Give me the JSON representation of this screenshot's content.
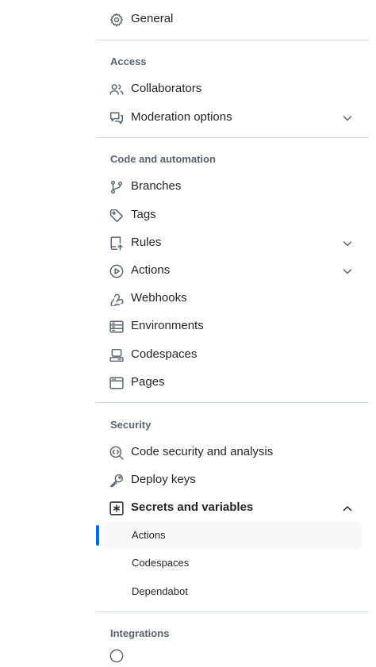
{
  "sidebar": {
    "general": {
      "label": "General",
      "icon": "gear-icon"
    },
    "access": {
      "title": "Access",
      "items": [
        {
          "label": "Collaborators",
          "icon": "people-icon"
        },
        {
          "label": "Moderation options",
          "icon": "comment-discussion-icon",
          "expandable": true,
          "expanded": false
        }
      ]
    },
    "code_automation": {
      "title": "Code and automation",
      "items": [
        {
          "label": "Branches",
          "icon": "git-branch-icon"
        },
        {
          "label": "Tags",
          "icon": "tag-icon"
        },
        {
          "label": "Rules",
          "icon": "repo-push-icon",
          "expandable": true,
          "expanded": false
        },
        {
          "label": "Actions",
          "icon": "play-icon",
          "expandable": true,
          "expanded": false
        },
        {
          "label": "Webhooks",
          "icon": "webhook-icon"
        },
        {
          "label": "Environments",
          "icon": "server-icon"
        },
        {
          "label": "Codespaces",
          "icon": "codespaces-icon"
        },
        {
          "label": "Pages",
          "icon": "browser-icon"
        }
      ]
    },
    "security": {
      "title": "Security",
      "items": [
        {
          "label": "Code security and analysis",
          "icon": "codescan-icon"
        },
        {
          "label": "Deploy keys",
          "icon": "key-icon"
        },
        {
          "label": "Secrets and variables",
          "icon": "asterisk-icon",
          "expandable": true,
          "expanded": true
        }
      ],
      "subitems": [
        {
          "label": "Actions",
          "active": true
        },
        {
          "label": "Codespaces",
          "active": false
        },
        {
          "label": "Dependabot",
          "active": false
        }
      ]
    },
    "integrations": {
      "title": "Integrations"
    }
  },
  "colors": {
    "text": "#1f2328",
    "muted": "#59636e",
    "divider": "#d1d9e0",
    "active_bg": "#f6f8fa",
    "accent": "#0969da"
  }
}
